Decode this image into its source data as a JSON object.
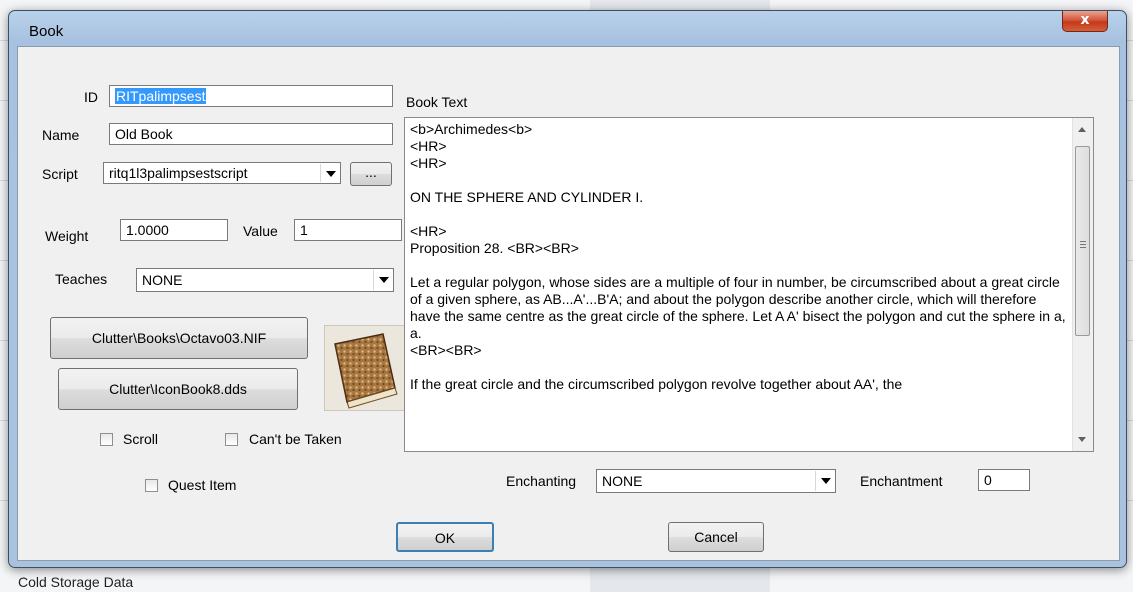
{
  "background": {
    "bottom_text": "Cold Storage Data"
  },
  "window": {
    "title": "Book",
    "close_glyph": "x"
  },
  "form": {
    "id_label": "ID",
    "id_value": "RITpalimpsest",
    "name_label": "Name",
    "name_value": "Old Book",
    "script_label": "Script",
    "script_value": "ritq1l3palimpsestscript",
    "script_browse_label": "...",
    "weight_label": "Weight",
    "weight_value": "1.0000",
    "value_label": "Value",
    "value_value": "1",
    "teaches_label": "Teaches",
    "teaches_value": "NONE",
    "model_button_label": "Clutter\\Books\\Octavo03.NIF",
    "icon_button_label": "Clutter\\IconBook8.dds",
    "scroll_label": "Scroll",
    "scroll_checked": false,
    "cant_be_taken_label": "Can't be Taken",
    "cant_be_taken_checked": false,
    "quest_item_label": "Quest Item",
    "quest_item_checked": false,
    "book_text_label": "Book Text",
    "book_text": "<b>Archimedes<b>\n<HR>\n<HR>\n\nON THE SPHERE AND CYLINDER I.\n\n<HR>\nProposition 28. <BR><BR>\n\nLet a regular polygon, whose sides are a multiple of four in number, be circumscribed about a great circle of a given sphere, as AB...A'...B'A; and about the polygon describe another circle, which will therefore have the same centre as the great circle of the sphere. Let A A' bisect the polygon and cut the sphere in a, a.\n<BR><BR>\n\nIf the great circle and the circumscribed polygon revolve together about AA', the",
    "enchanting_label": "Enchanting",
    "enchanting_value": "NONE",
    "enchantment_label": "Enchantment",
    "enchantment_value": "0"
  },
  "buttons": {
    "ok": "OK",
    "cancel": "Cancel"
  }
}
